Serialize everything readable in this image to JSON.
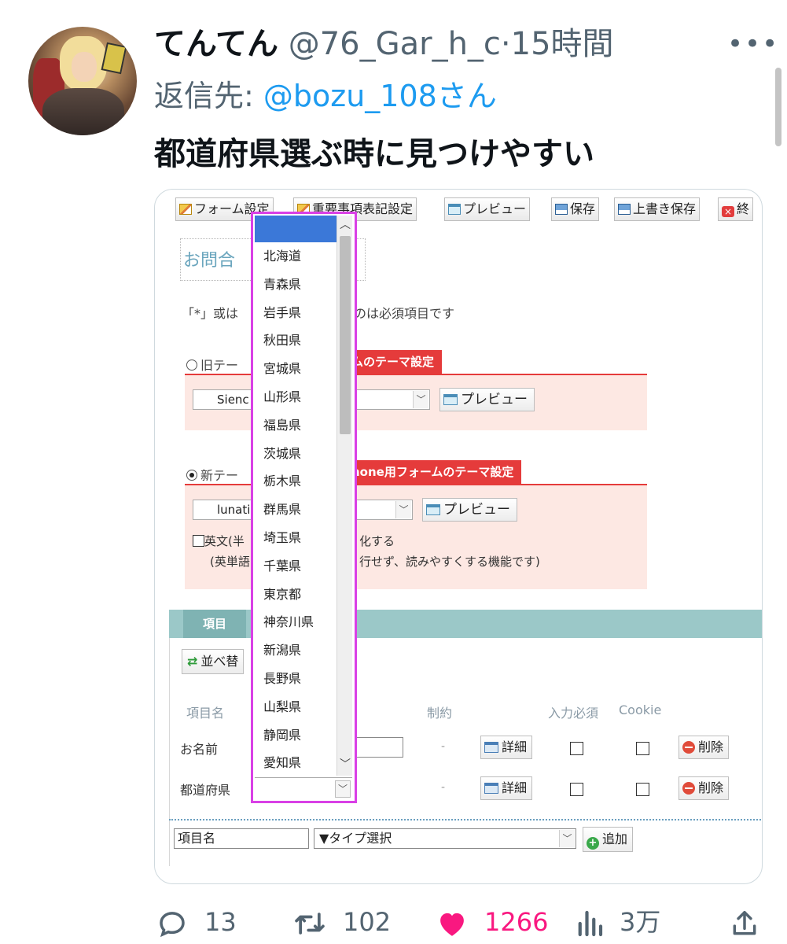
{
  "tweet": {
    "display_name": "てんてん",
    "handle": "@76_Gar_h_c",
    "separator": "·",
    "time": "15時間",
    "reply_prefix": "返信先: ",
    "reply_mention": "@bozu_108さん",
    "text": "都道府県選ぶ時に見つけやすい"
  },
  "screenshot": {
    "toolbar": [
      "フォーム設定",
      "重要事項表記設定",
      "プレビュー",
      "保存",
      "上書き保存",
      "終"
    ],
    "form_title": "お問合",
    "form_title_tail": "ム",
    "required_note_start": "「*」或は",
    "required_note_end": "ものは必須項目です",
    "old_theme_label": "旧テー",
    "old_theme_tab": "ムのテーマ設定",
    "old_theme_value": "Sienc",
    "new_theme_label": "新テー",
    "new_theme_tab": "hone用フォームのテーマ設定",
    "new_theme_value": "lunati",
    "preview_label": "プレビュー",
    "english_label": "英文(半",
    "english_tail": "化する",
    "english_note_start": "(英単語",
    "english_note_end": "行せず、読みやすくする機能です)",
    "items_tab": "項目",
    "sort_button": "並べ替",
    "columns": {
      "name": "項目名",
      "constraint": "制約",
      "required": "入力必須",
      "cookie": "Cookie"
    },
    "rows": [
      {
        "label": "お名前",
        "dash": "-",
        "detail": "詳細",
        "delete": "削除"
      },
      {
        "label": "都道府県",
        "dash": "-",
        "detail": "詳細",
        "delete": "削除"
      }
    ],
    "new_item_name": "項目名",
    "type_select": "▼タイプ選択",
    "add_button": "追加",
    "dropdown_options": [
      "北海道",
      "青森県",
      "岩手県",
      "秋田県",
      "宮城県",
      "山形県",
      "福島県",
      "茨城県",
      "栃木県",
      "群馬県",
      "埼玉県",
      "千葉県",
      "東京都",
      "神奈川県",
      "新潟県",
      "長野県",
      "山梨県",
      "静岡県",
      "愛知県"
    ],
    "highlight_color": "#d940e6",
    "selected_color": "#3b78d8"
  },
  "actions": {
    "replies": "13",
    "retweets": "102",
    "likes": "1266",
    "views": "3万",
    "liked": true,
    "like_color": "#f91880"
  }
}
